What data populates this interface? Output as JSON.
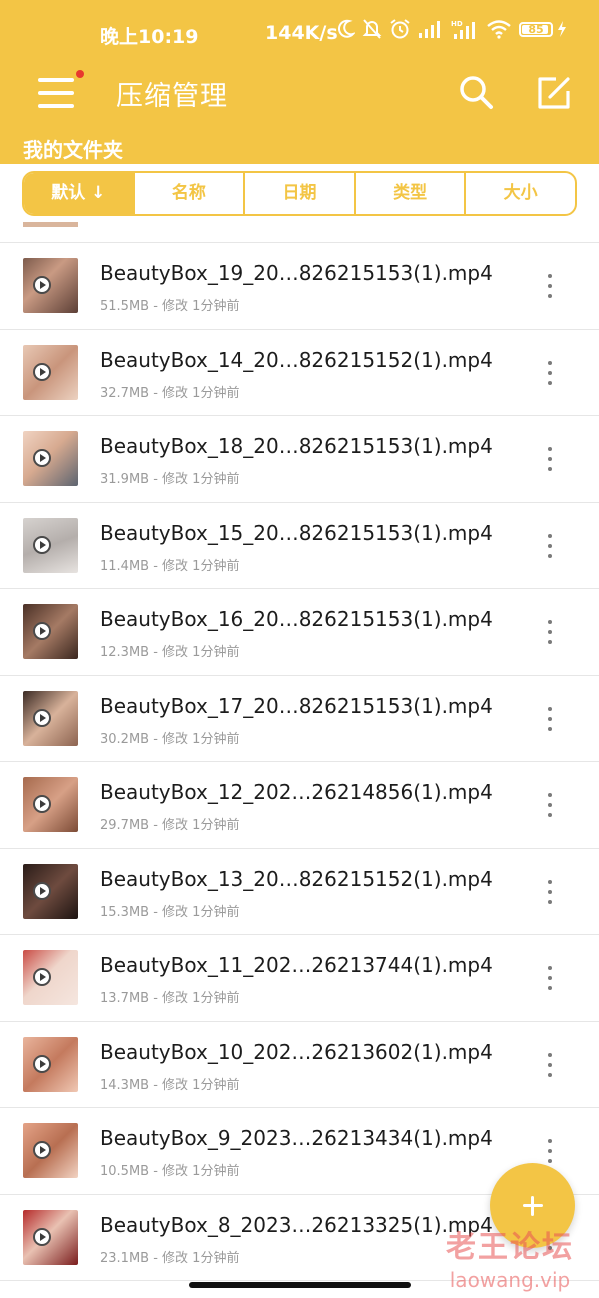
{
  "status_bar": {
    "time": "晚上10:19",
    "net_speed": "144K/s",
    "battery": "85"
  },
  "app_bar": {
    "title": "压缩管理",
    "icons": [
      "menu-icon",
      "search-icon",
      "edit-icon"
    ]
  },
  "folder_label": "我的文件夹",
  "sort_tabs": [
    {
      "label": "默认 ↓",
      "active": true
    },
    {
      "label": "名称",
      "active": false
    },
    {
      "label": "日期",
      "active": false
    },
    {
      "label": "类型",
      "active": false
    },
    {
      "label": "大小",
      "active": false
    }
  ],
  "files": [
    {
      "name": "BeautyBox_19_20…826215153(1).mp4",
      "meta": "51.5MB - 修改 1分钟前"
    },
    {
      "name": "BeautyBox_14_20…826215152(1).mp4",
      "meta": "32.7MB - 修改 1分钟前"
    },
    {
      "name": "BeautyBox_18_20…826215153(1).mp4",
      "meta": "31.9MB - 修改 1分钟前"
    },
    {
      "name": "BeautyBox_15_20…826215153(1).mp4",
      "meta": "11.4MB - 修改 1分钟前"
    },
    {
      "name": "BeautyBox_16_20…826215153(1).mp4",
      "meta": "12.3MB - 修改 1分钟前"
    },
    {
      "name": "BeautyBox_17_20…826215153(1).mp4",
      "meta": "30.2MB - 修改 1分钟前"
    },
    {
      "name": "BeautyBox_12_202…26214856(1).mp4",
      "meta": "29.7MB - 修改 1分钟前"
    },
    {
      "name": "BeautyBox_13_20…826215152(1).mp4",
      "meta": "15.3MB - 修改 1分钟前"
    },
    {
      "name": "BeautyBox_11_202…26213744(1).mp4",
      "meta": "13.7MB - 修改 1分钟前"
    },
    {
      "name": "BeautyBox_10_202…26213602(1).mp4",
      "meta": "14.3MB - 修改 1分钟前"
    },
    {
      "name": "BeautyBox_9_2023…26213434(1).mp4",
      "meta": "10.5MB - 修改 1分钟前"
    },
    {
      "name": "BeautyBox_8_2023…26213325(1).mp4",
      "meta": "23.1MB - 修改 1分钟前"
    }
  ],
  "fab": {
    "icon": "plus-icon"
  },
  "watermark": {
    "text": "老王论坛",
    "url": "laowang.vip"
  },
  "colors": {
    "accent": "#f3c545",
    "text": "#1c1c1c",
    "meta": "#9a9a9a",
    "divider": "#e6e6e6",
    "badge": "#e8382e"
  }
}
